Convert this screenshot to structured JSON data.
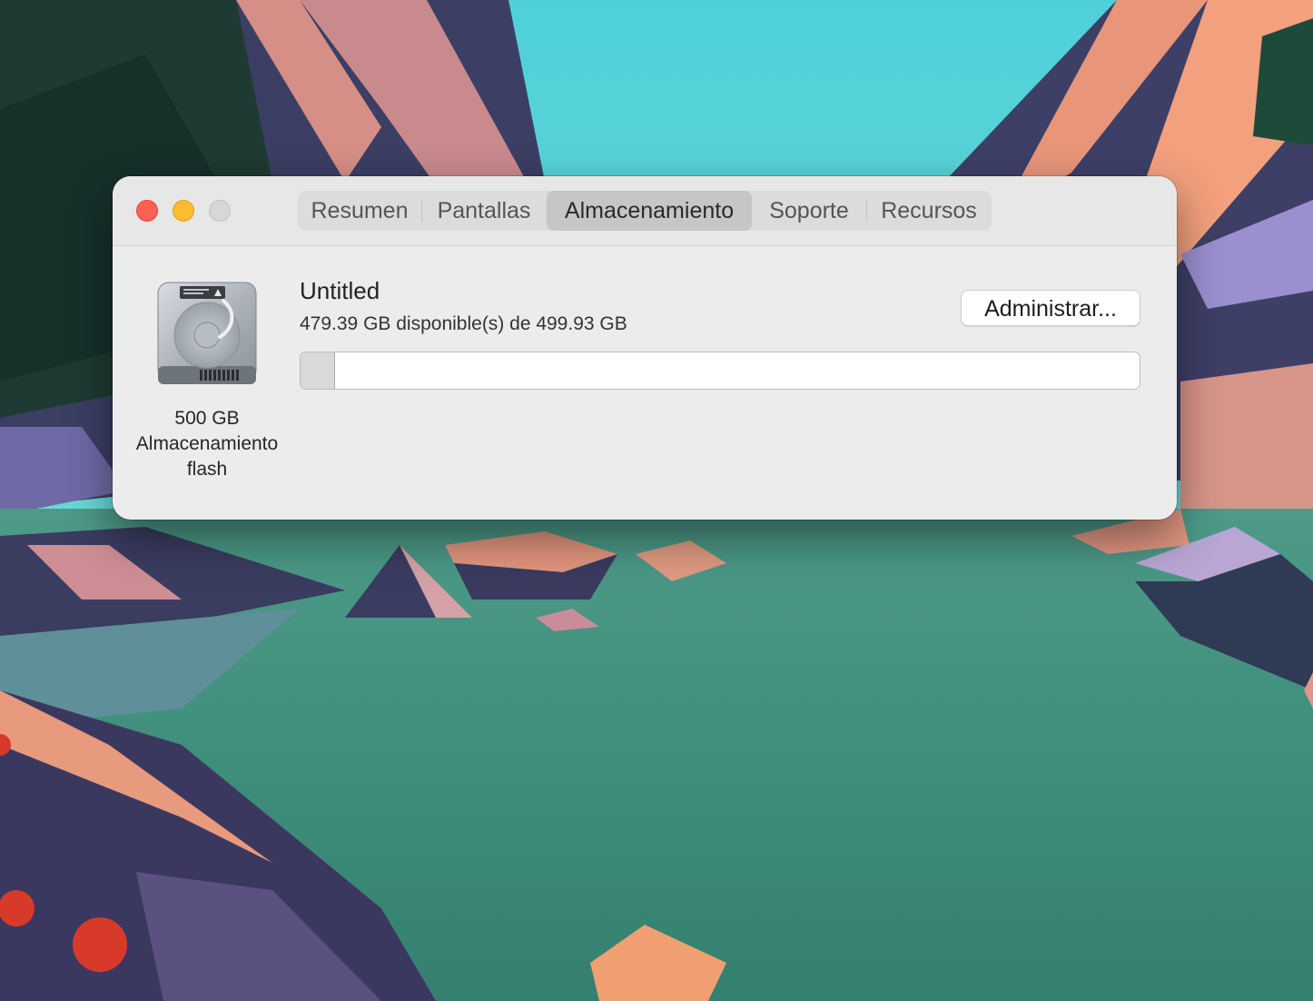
{
  "window": {
    "tabs": [
      {
        "label": "Resumen",
        "active": false
      },
      {
        "label": "Pantallas",
        "active": false
      },
      {
        "label": "Almacenamiento",
        "active": true
      },
      {
        "label": "Soporte",
        "active": false
      },
      {
        "label": "Recursos",
        "active": false
      }
    ],
    "traffic_lights": {
      "close_color": "#fe5f57",
      "minimize_color": "#febc2e",
      "zoom_color": "#d7d7d7"
    }
  },
  "storage": {
    "disk_icon": "hard-drive-icon",
    "disk_caption_line1": "500 GB",
    "disk_caption_line2": "Almacenamiento",
    "disk_caption_line3": "flash",
    "volume_name": "Untitled",
    "volume_info": "479.39 GB disponible(s) de 499.93 GB",
    "manage_label": "Administrar...",
    "used_fraction": 0.041
  }
}
